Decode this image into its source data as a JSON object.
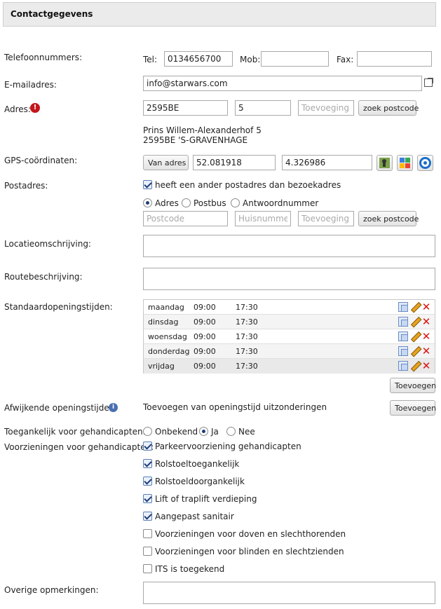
{
  "header": {
    "title": "Contactgegevens"
  },
  "phone": {
    "label": "Telefoonnummers:",
    "tel_label": "Tel:",
    "tel_value": "0134656700",
    "mob_label": "Mob:",
    "mob_value": "",
    "fax_label": "Fax:",
    "fax_value": ""
  },
  "email": {
    "label": "E-mailadres:",
    "value": "info@starwars.com"
  },
  "address": {
    "label": "Adres:",
    "postcode": "2595BE",
    "number": "5",
    "addition_placeholder": "Toevoeging",
    "lookup_button": "zoek postcode",
    "line1": "Prins Willem-Alexanderhof 5",
    "line2": "2595BE 'S-GRAVENHAGE"
  },
  "gps": {
    "label": "GPS-coördinaten:",
    "from_address_button": "Van adres",
    "lat": "52.081918",
    "lon": "4.326986"
  },
  "postal": {
    "label": "Postadres:",
    "different_checkbox": "heeft een ander postadres dan bezoekadres",
    "radio_options": [
      "Adres",
      "Postbus",
      "Antwoordnummer"
    ],
    "selected": "Adres",
    "postcode_placeholder": "Postcode",
    "number_placeholder": "Huisnummer",
    "addition_placeholder": "Toevoeging",
    "lookup_button": "zoek postcode"
  },
  "location_description": {
    "label": "Locatieomschrijving:"
  },
  "route_description": {
    "label": "Routebeschrijving:"
  },
  "opening_hours": {
    "label": "Standaardopeningstijden:",
    "rows": [
      {
        "day": "maandag",
        "from": "09:00",
        "to": "17:30"
      },
      {
        "day": "dinsdag",
        "from": "09:00",
        "to": "17:30"
      },
      {
        "day": "woensdag",
        "from": "09:00",
        "to": "17:30"
      },
      {
        "day": "donderdag",
        "from": "09:00",
        "to": "17:30"
      },
      {
        "day": "vrijdag",
        "from": "09:00",
        "to": "17:30"
      }
    ],
    "add_button": "Toevoegen"
  },
  "exceptions": {
    "label": "Afwijkende openingstijden:",
    "text": "Toevoegen van openingstijd uitzonderingen",
    "add_button": "Toevoegen"
  },
  "accessible": {
    "label": "Toegankelijk voor gehandicapten:",
    "options": [
      "Onbekend",
      "Ja",
      "Nee"
    ],
    "selected": "Ja"
  },
  "facilities": {
    "label": "Voorzieningen voor gehandicapten:",
    "items": [
      {
        "label": "Parkeervoorziening gehandicapten",
        "checked": true
      },
      {
        "label": "Rolstoeltoegankelijk",
        "checked": true
      },
      {
        "label": "Rolstoeldoorgankelijk",
        "checked": true
      },
      {
        "label": "Lift of traplift verdieping",
        "checked": true
      },
      {
        "label": "Aangepast sanitair",
        "checked": true
      },
      {
        "label": "Voorzieningen voor doven en slechthorenden",
        "checked": false
      },
      {
        "label": "Voorzieningen voor blinden en slechtzienden",
        "checked": false
      },
      {
        "label": "ITS is toegekend",
        "checked": false
      }
    ]
  },
  "remarks": {
    "label": "Overige opmerkingen:"
  }
}
